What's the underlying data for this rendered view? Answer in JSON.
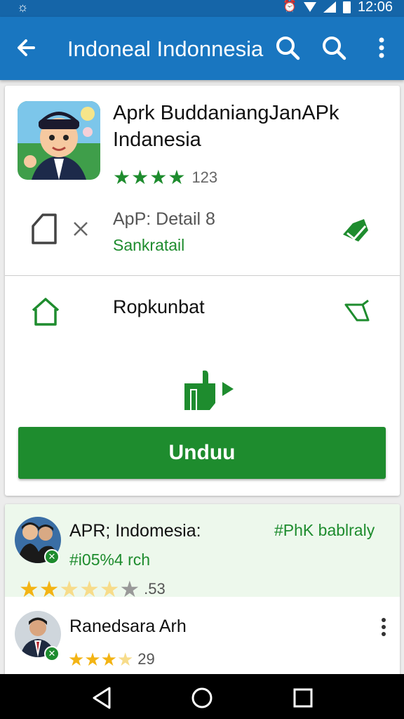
{
  "status_bar": {
    "time": "12:06",
    "left_icon": "brightness-icon"
  },
  "app_bar": {
    "title": "Indoneal Indonnesia",
    "icons": [
      "back-arrow-icon",
      "search-icon",
      "search-icon",
      "more-vert-icon"
    ]
  },
  "app": {
    "name": "Aprk BuddaniangJanAPk Indanesia",
    "rating_count": "123",
    "star_count": 4,
    "detail_label": "ApP: Detail 8",
    "detail_sub": "Sankratail",
    "section_label": "Ropkunbat",
    "download_label": "Unduu"
  },
  "reviews": [
    {
      "name": "APR; Indomesia:",
      "sub": "#i05%4 rch",
      "tag": "#PhK bablraly",
      "rating_count": ".53",
      "stars": 4.5
    },
    {
      "name": "Ranedsara Arh",
      "rating_count": "29",
      "stars": 3.5
    }
  ],
  "nav": {
    "icons": [
      "back-triangle-icon",
      "home-circle-icon",
      "recents-square-icon"
    ]
  },
  "colors": {
    "appbar": "#1976c0",
    "statusbar": "#1565a8",
    "accent_green": "#1e8c2e",
    "star_gold": "#f3b414"
  }
}
